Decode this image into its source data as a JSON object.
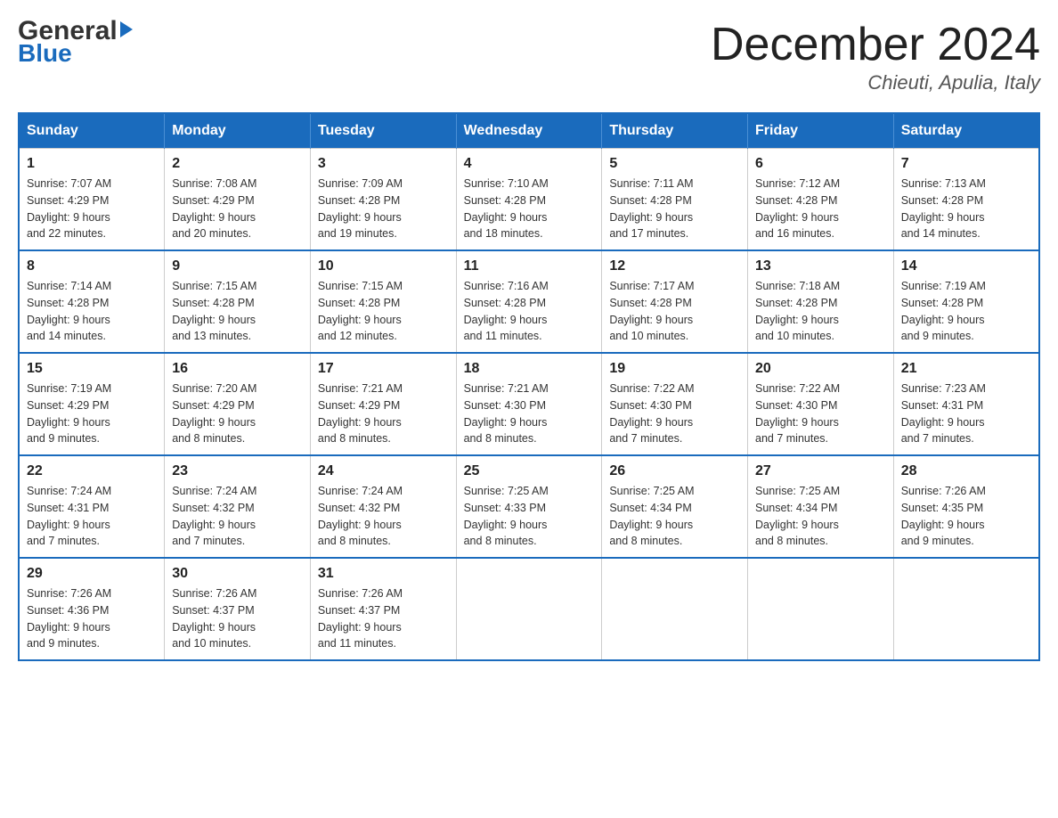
{
  "header": {
    "logo_general": "General",
    "logo_blue": "Blue",
    "month_title": "December 2024",
    "location": "Chieuti, Apulia, Italy"
  },
  "weekdays": [
    "Sunday",
    "Monday",
    "Tuesday",
    "Wednesday",
    "Thursday",
    "Friday",
    "Saturday"
  ],
  "weeks": [
    [
      {
        "day": "1",
        "sunrise": "7:07 AM",
        "sunset": "4:29 PM",
        "daylight": "9 hours and 22 minutes."
      },
      {
        "day": "2",
        "sunrise": "7:08 AM",
        "sunset": "4:29 PM",
        "daylight": "9 hours and 20 minutes."
      },
      {
        "day": "3",
        "sunrise": "7:09 AM",
        "sunset": "4:28 PM",
        "daylight": "9 hours and 19 minutes."
      },
      {
        "day": "4",
        "sunrise": "7:10 AM",
        "sunset": "4:28 PM",
        "daylight": "9 hours and 18 minutes."
      },
      {
        "day": "5",
        "sunrise": "7:11 AM",
        "sunset": "4:28 PM",
        "daylight": "9 hours and 17 minutes."
      },
      {
        "day": "6",
        "sunrise": "7:12 AM",
        "sunset": "4:28 PM",
        "daylight": "9 hours and 16 minutes."
      },
      {
        "day": "7",
        "sunrise": "7:13 AM",
        "sunset": "4:28 PM",
        "daylight": "9 hours and 14 minutes."
      }
    ],
    [
      {
        "day": "8",
        "sunrise": "7:14 AM",
        "sunset": "4:28 PM",
        "daylight": "9 hours and 14 minutes."
      },
      {
        "day": "9",
        "sunrise": "7:15 AM",
        "sunset": "4:28 PM",
        "daylight": "9 hours and 13 minutes."
      },
      {
        "day": "10",
        "sunrise": "7:15 AM",
        "sunset": "4:28 PM",
        "daylight": "9 hours and 12 minutes."
      },
      {
        "day": "11",
        "sunrise": "7:16 AM",
        "sunset": "4:28 PM",
        "daylight": "9 hours and 11 minutes."
      },
      {
        "day": "12",
        "sunrise": "7:17 AM",
        "sunset": "4:28 PM",
        "daylight": "9 hours and 10 minutes."
      },
      {
        "day": "13",
        "sunrise": "7:18 AM",
        "sunset": "4:28 PM",
        "daylight": "9 hours and 10 minutes."
      },
      {
        "day": "14",
        "sunrise": "7:19 AM",
        "sunset": "4:28 PM",
        "daylight": "9 hours and 9 minutes."
      }
    ],
    [
      {
        "day": "15",
        "sunrise": "7:19 AM",
        "sunset": "4:29 PM",
        "daylight": "9 hours and 9 minutes."
      },
      {
        "day": "16",
        "sunrise": "7:20 AM",
        "sunset": "4:29 PM",
        "daylight": "9 hours and 8 minutes."
      },
      {
        "day": "17",
        "sunrise": "7:21 AM",
        "sunset": "4:29 PM",
        "daylight": "9 hours and 8 minutes."
      },
      {
        "day": "18",
        "sunrise": "7:21 AM",
        "sunset": "4:30 PM",
        "daylight": "9 hours and 8 minutes."
      },
      {
        "day": "19",
        "sunrise": "7:22 AM",
        "sunset": "4:30 PM",
        "daylight": "9 hours and 7 minutes."
      },
      {
        "day": "20",
        "sunrise": "7:22 AM",
        "sunset": "4:30 PM",
        "daylight": "9 hours and 7 minutes."
      },
      {
        "day": "21",
        "sunrise": "7:23 AM",
        "sunset": "4:31 PM",
        "daylight": "9 hours and 7 minutes."
      }
    ],
    [
      {
        "day": "22",
        "sunrise": "7:24 AM",
        "sunset": "4:31 PM",
        "daylight": "9 hours and 7 minutes."
      },
      {
        "day": "23",
        "sunrise": "7:24 AM",
        "sunset": "4:32 PM",
        "daylight": "9 hours and 7 minutes."
      },
      {
        "day": "24",
        "sunrise": "7:24 AM",
        "sunset": "4:32 PM",
        "daylight": "9 hours and 8 minutes."
      },
      {
        "day": "25",
        "sunrise": "7:25 AM",
        "sunset": "4:33 PM",
        "daylight": "9 hours and 8 minutes."
      },
      {
        "day": "26",
        "sunrise": "7:25 AM",
        "sunset": "4:34 PM",
        "daylight": "9 hours and 8 minutes."
      },
      {
        "day": "27",
        "sunrise": "7:25 AM",
        "sunset": "4:34 PM",
        "daylight": "9 hours and 8 minutes."
      },
      {
        "day": "28",
        "sunrise": "7:26 AM",
        "sunset": "4:35 PM",
        "daylight": "9 hours and 9 minutes."
      }
    ],
    [
      {
        "day": "29",
        "sunrise": "7:26 AM",
        "sunset": "4:36 PM",
        "daylight": "9 hours and 9 minutes."
      },
      {
        "day": "30",
        "sunrise": "7:26 AM",
        "sunset": "4:37 PM",
        "daylight": "9 hours and 10 minutes."
      },
      {
        "day": "31",
        "sunrise": "7:26 AM",
        "sunset": "4:37 PM",
        "daylight": "9 hours and 11 minutes."
      },
      null,
      null,
      null,
      null
    ]
  ],
  "labels": {
    "sunrise": "Sunrise:",
    "sunset": "Sunset:",
    "daylight": "Daylight:"
  }
}
